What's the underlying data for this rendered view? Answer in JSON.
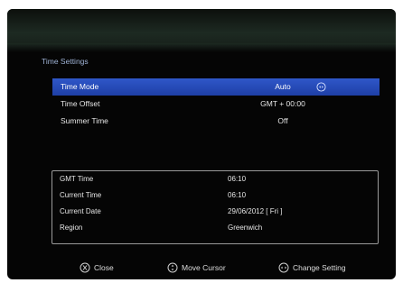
{
  "menu": {
    "title": "Time Settings",
    "settings": [
      {
        "label": "Time Mode",
        "value": "Auto"
      },
      {
        "label": "Time Offset",
        "value": "GMT + 00:00"
      },
      {
        "label": "Summer Time",
        "value": "Off"
      }
    ],
    "selected_index": 0
  },
  "info": [
    {
      "label": "GMT Time",
      "value": "06:10"
    },
    {
      "label": "Current Time",
      "value": "06:10"
    },
    {
      "label": "Current Date",
      "value": "29/06/2012 [ Fri ]"
    },
    {
      "label": "Region",
      "value": "Greenwich"
    }
  ],
  "footer": {
    "close_label": "Close",
    "move_label": "Move Cursor",
    "change_label": "Change Setting",
    "close_icon": "exit-key-icon",
    "move_icon": "ok-key-icon",
    "change_icon": "left-right-key-icon"
  },
  "colors": {
    "selection": "#2a4fc2",
    "title": "#9fb3d6",
    "background": "#050505"
  }
}
